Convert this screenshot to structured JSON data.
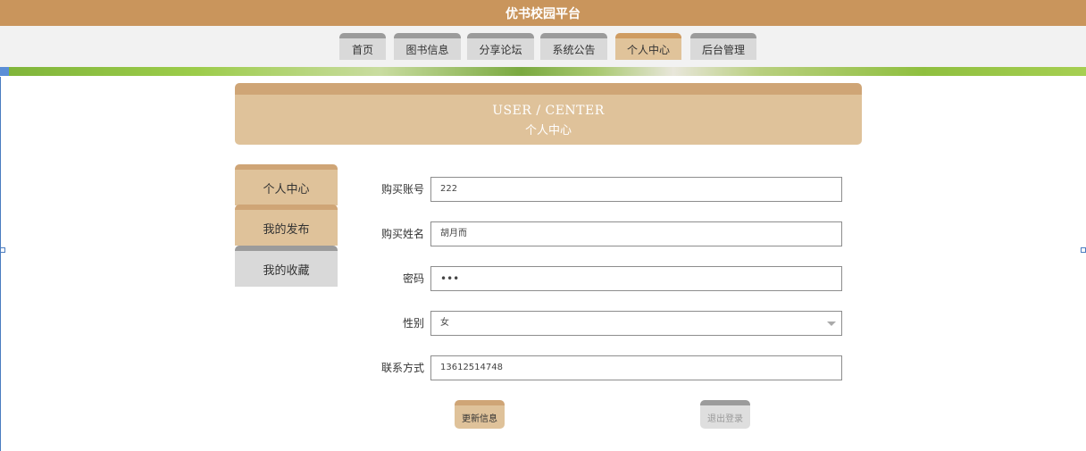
{
  "app": {
    "title": "优书校园平台"
  },
  "nav": {
    "items": [
      {
        "label": "首页"
      },
      {
        "label": "图书信息"
      },
      {
        "label": "分享论坛"
      },
      {
        "label": "系统公告"
      },
      {
        "label": "个人中心",
        "active": true
      },
      {
        "label": "后台管理"
      }
    ]
  },
  "header": {
    "en": "USER / CENTER",
    "zh": "个人中心"
  },
  "sidebar": {
    "items": [
      {
        "label": "个人中心"
      },
      {
        "label": "我的发布"
      },
      {
        "label": "我的收藏"
      }
    ]
  },
  "form": {
    "account": {
      "label": "购买账号",
      "value": "222"
    },
    "name": {
      "label": "购买姓名",
      "value": "胡月而"
    },
    "password": {
      "label": "密码",
      "value": "•••"
    },
    "gender": {
      "label": "性别",
      "value": "女"
    },
    "contact": {
      "label": "联系方式",
      "value": "13612514748"
    }
  },
  "buttons": {
    "update": "更新信息",
    "logout": "退出登录"
  },
  "colors": {
    "brand": "#c9955c",
    "tab_active": "#e0c39a",
    "tab_inactive": "#d9d9d9"
  }
}
